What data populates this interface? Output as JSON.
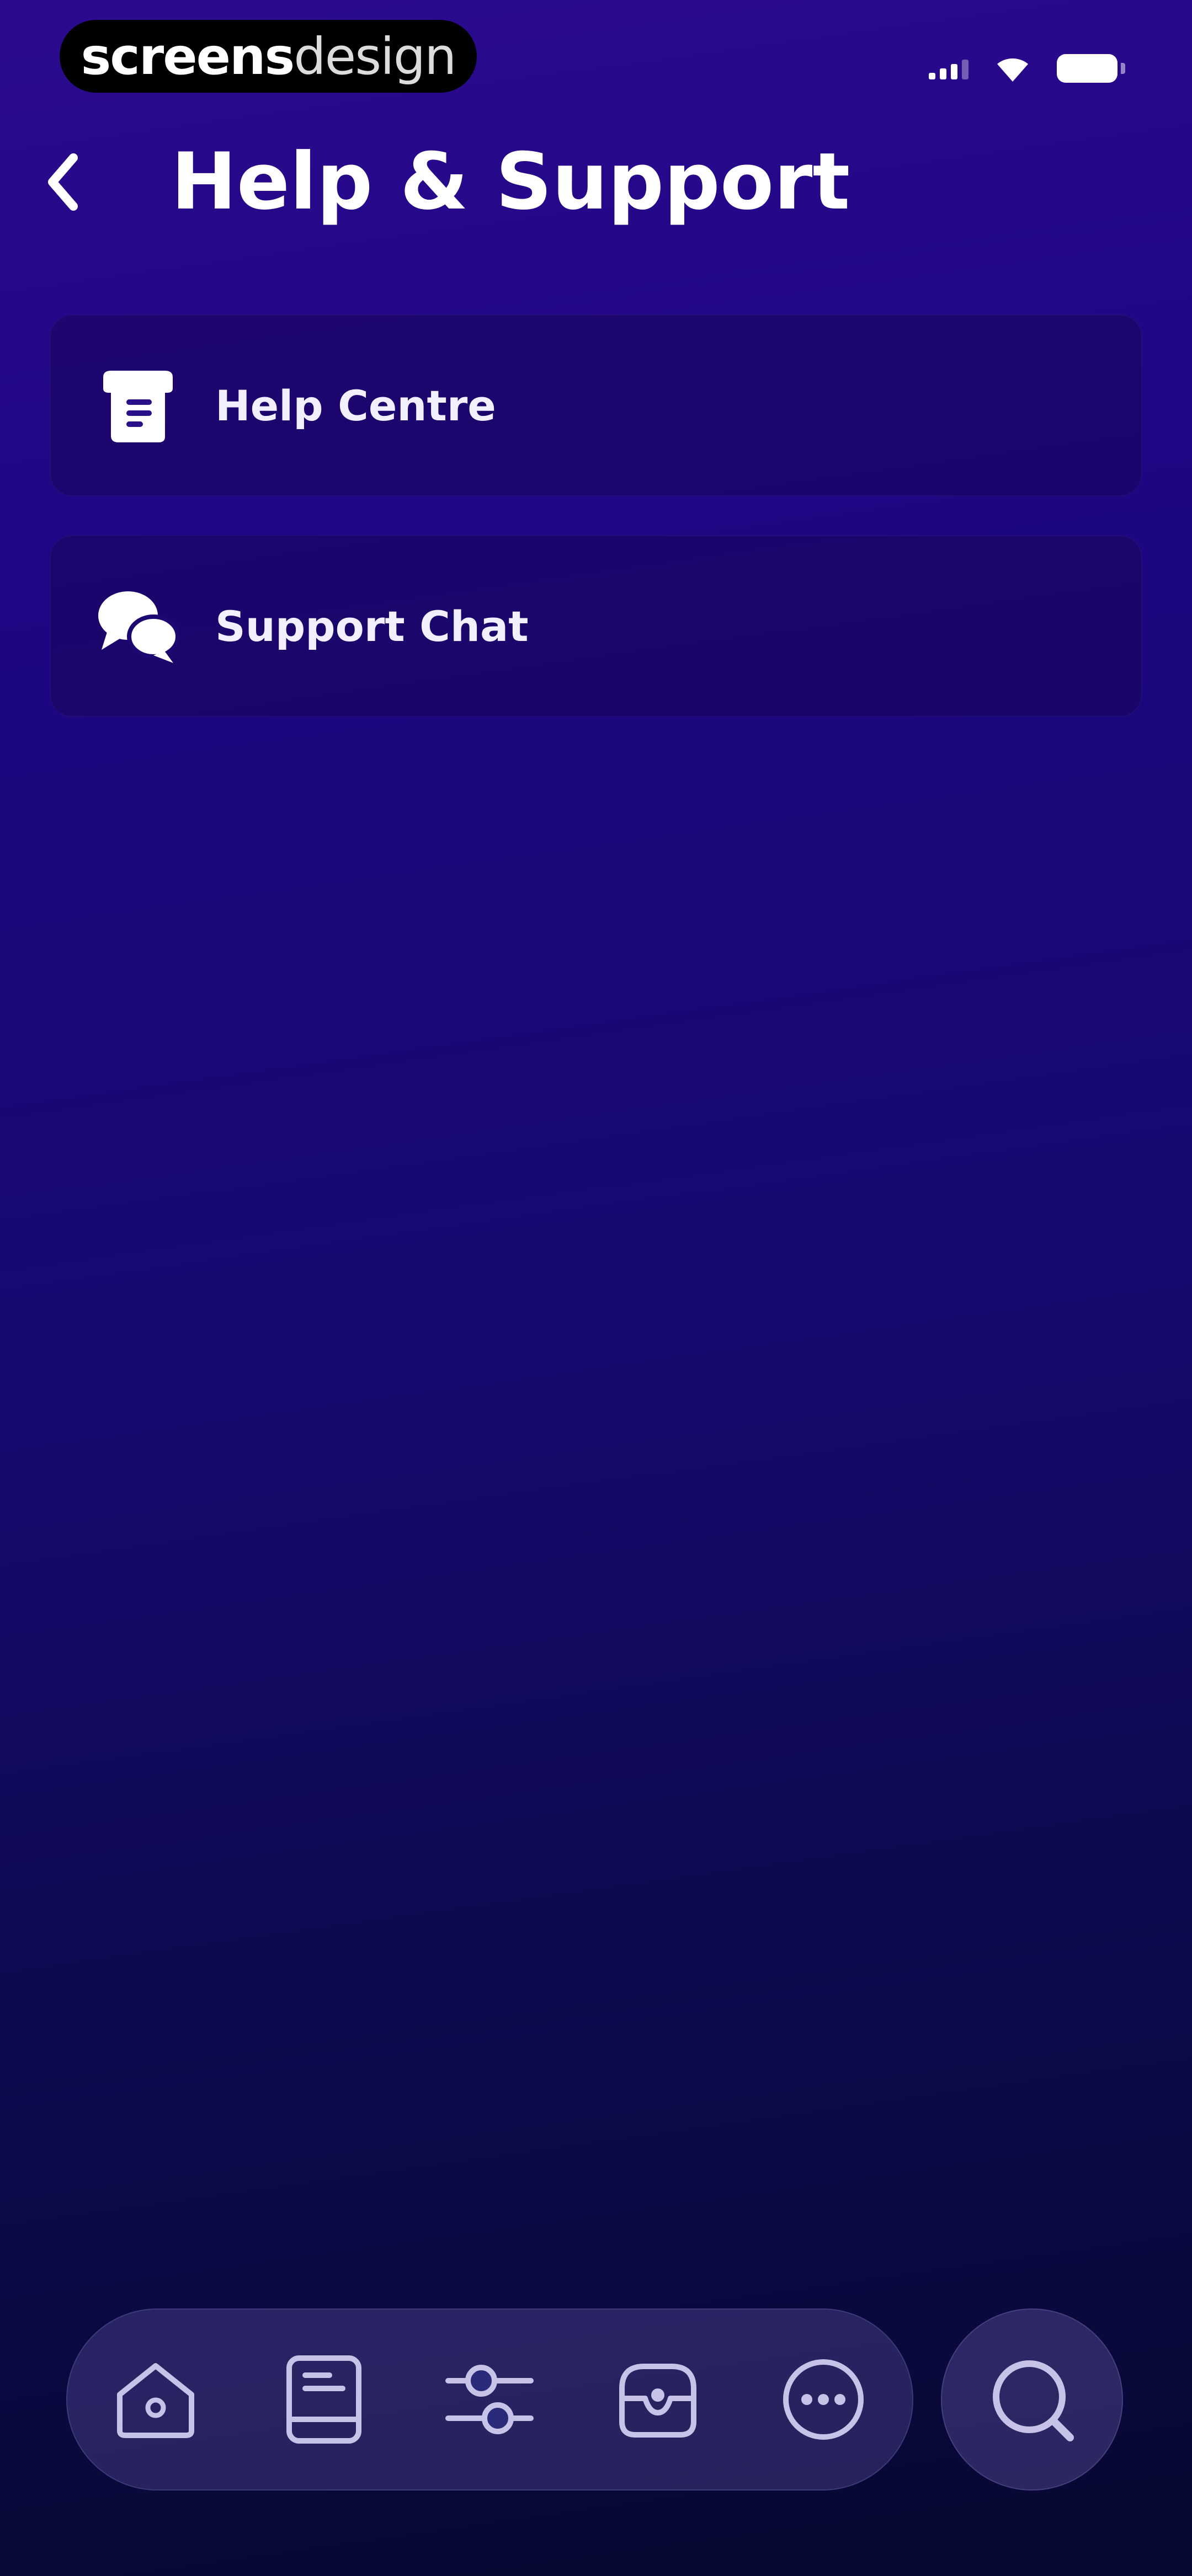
{
  "status_bar": {
    "watermark_bold": "screens",
    "watermark_light": "design"
  },
  "header": {
    "title": "Help & Support",
    "back_icon": "chevron-left-icon"
  },
  "menu": {
    "items": [
      {
        "label": "Help Centre",
        "icon": "help-book-icon"
      },
      {
        "label": "Support Chat",
        "icon": "chat-bubbles-icon"
      }
    ]
  },
  "tabbar": {
    "items": [
      {
        "icon": "home-icon"
      },
      {
        "icon": "document-icon"
      },
      {
        "icon": "sliders-icon"
      },
      {
        "icon": "inbox-icon"
      },
      {
        "icon": "more-icon"
      }
    ],
    "search_icon": "search-icon"
  },
  "colors": {
    "background_top": "#2c0a8e",
    "background_bottom": "#070831",
    "card": "#1a065a",
    "nav_pill": "#7868be",
    "text": "#ffffff"
  }
}
